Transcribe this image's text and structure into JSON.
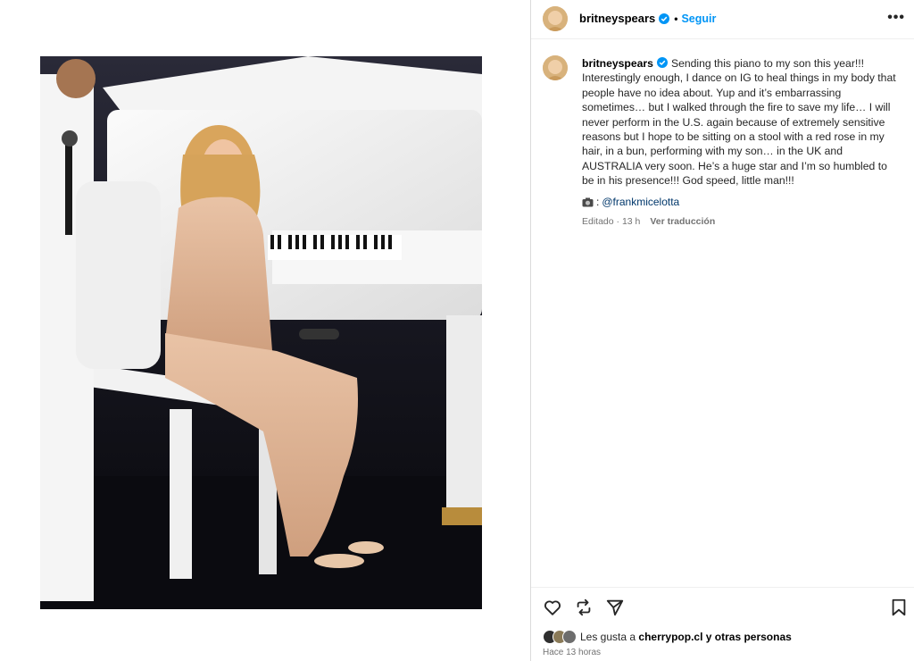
{
  "post": {
    "username": "britneyspears",
    "dot": "•",
    "follow_label": "Seguir",
    "more_label": "•••",
    "caption_username": "britneyspears",
    "caption": "Sending this piano to my son this year!!! Interestingly enough, I dance on IG to heal things in my body that people have no idea about. Yup and it’s embarrassing sometimes… but I walked through the fire to save my life… I will never perform in the U.S. again because of extremely sensitive reasons but I hope to be sitting on a stool with a red rose in my hair, in a bun, performing with my son… in the UK and AUSTRALIA very soon. He’s a huge star and I’m so humbled to be in his presence!!! God speed, little man!!!",
    "credit_prefix": ":",
    "credit_mention": "@frankmicelotta",
    "edited_time": "Editado · 13 h",
    "translate_label": "Ver traducción",
    "likes_prefix": "Les gusta a",
    "likes_user": "cherrypop.cl",
    "likes_suffix": "y otras personas",
    "posted_time": "Hace 13 horas"
  },
  "icons": {
    "verified": "verified-badge-icon",
    "like": "heart-icon",
    "repost": "repost-icon",
    "share": "send-icon",
    "save": "bookmark-icon",
    "credit": "camera-icon"
  },
  "colors": {
    "link": "#0095f6",
    "mention": "#00376b",
    "secondary_text": "#737373"
  }
}
